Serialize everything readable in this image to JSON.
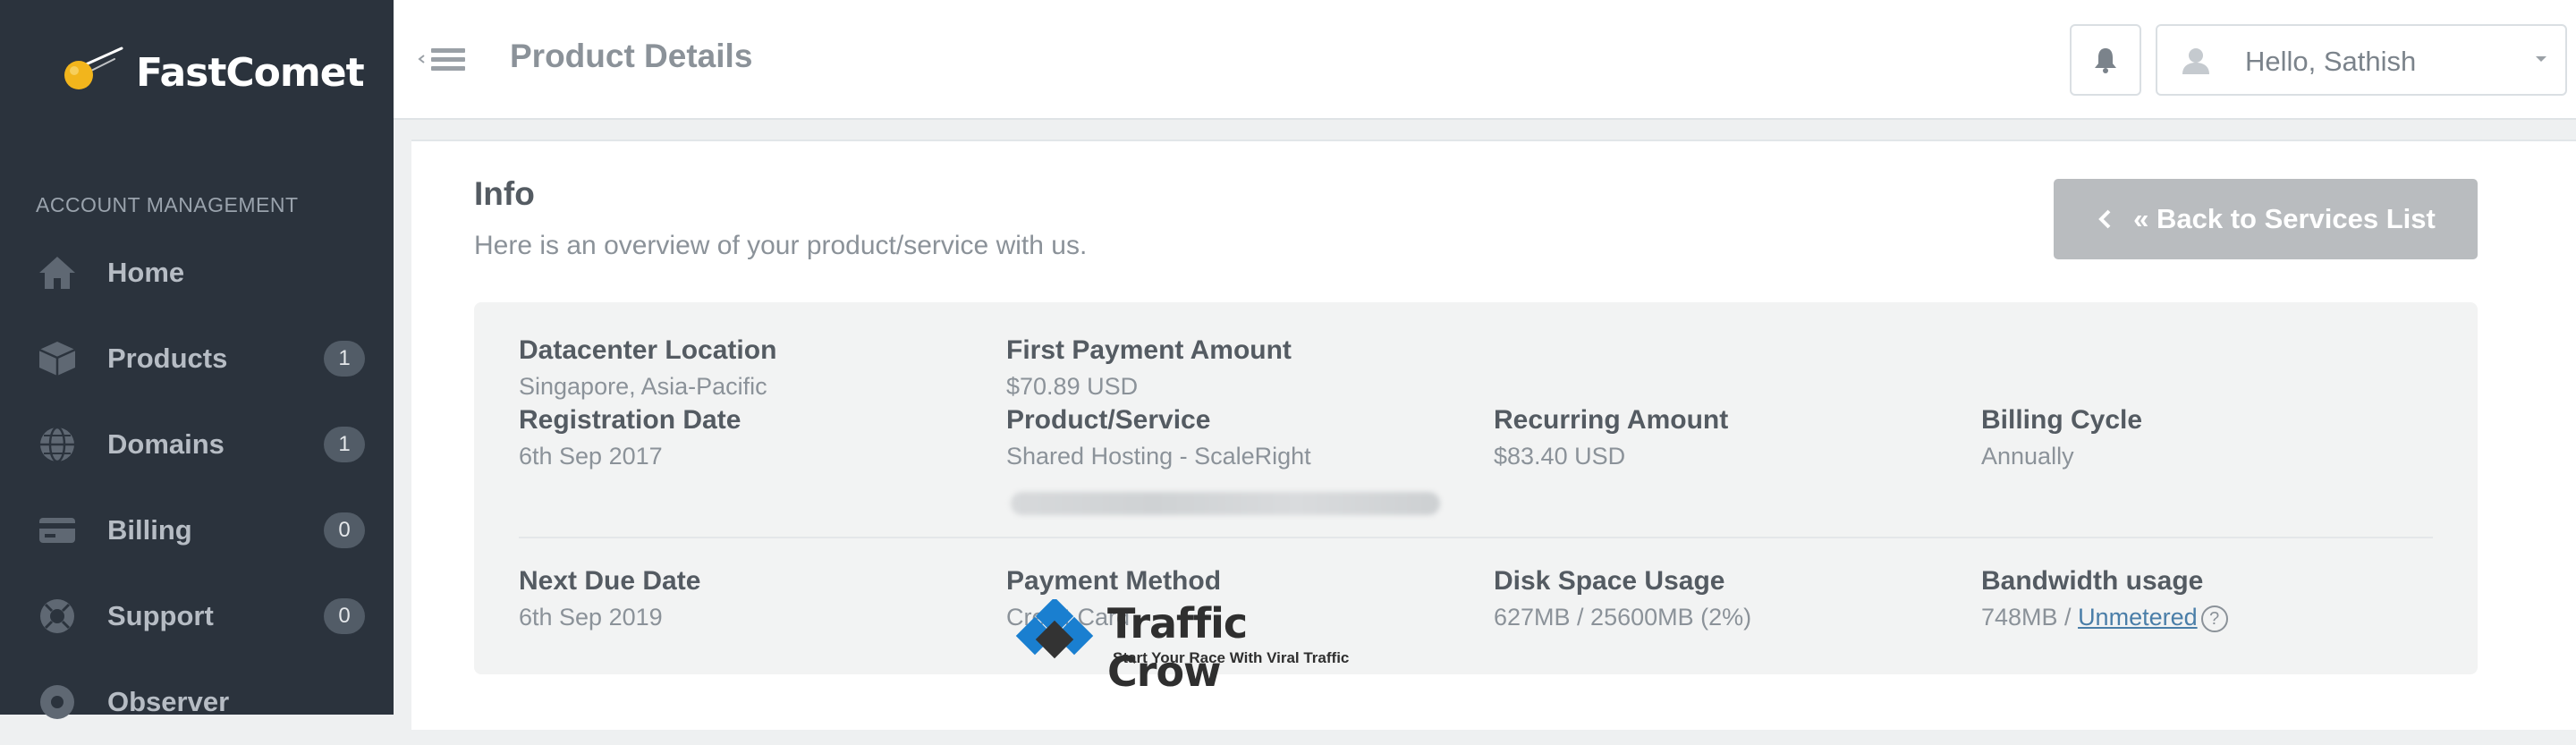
{
  "sidebar": {
    "brand": "FastComet",
    "heading": "ACCOUNT MANAGEMENT",
    "items": [
      {
        "label": "Home",
        "icon": "home-icon",
        "badge": ""
      },
      {
        "label": "Products",
        "icon": "box-icon",
        "badge": "1"
      },
      {
        "label": "Domains",
        "icon": "globe-icon",
        "badge": "1"
      },
      {
        "label": "Billing",
        "icon": "credit-card-icon",
        "badge": "0"
      },
      {
        "label": "Support",
        "icon": "lifebuoy-icon",
        "badge": "0"
      },
      {
        "label": "Observer",
        "icon": "eye-icon",
        "badge": ""
      }
    ]
  },
  "header": {
    "title": "Product Details",
    "user_greeting": "Hello, Sathish"
  },
  "info": {
    "title": "Info",
    "subtitle": "Here is an overview of your product/service with us.",
    "back_label": "« Back to Services List"
  },
  "fields": {
    "datacenter": {
      "label": "Datacenter Location",
      "value": "Singapore, Asia-Pacific"
    },
    "first_payment": {
      "label": "First Payment Amount",
      "value": "$70.89 USD"
    },
    "registration": {
      "label": "Registration Date",
      "value": "6th Sep 2017"
    },
    "product": {
      "label": "Product/Service",
      "value": "Shared Hosting - ScaleRight"
    },
    "recurring": {
      "label": "Recurring Amount",
      "value": "$83.40 USD"
    },
    "billing_cycle": {
      "label": "Billing Cycle",
      "value": "Annually"
    },
    "next_due": {
      "label": "Next Due Date",
      "value": "6th Sep 2019"
    },
    "payment_method": {
      "label": "Payment Method",
      "value": "Credit Card"
    },
    "disk": {
      "label": "Disk Space Usage",
      "value": "627MB / 25600MB (2%)"
    },
    "bandwidth": {
      "label": "Bandwidth usage",
      "value_prefix": "748MB / ",
      "link": "Unmetered",
      "help": "?"
    }
  },
  "watermark": {
    "name": "Traffic Crow",
    "tagline": "Start Your Race With Viral Traffic"
  },
  "colors": {
    "sidebar_bg": "#2b333d",
    "button_gray": "#b9bcbf",
    "link": "#4a7ea8",
    "comet": "#f2b51c"
  }
}
